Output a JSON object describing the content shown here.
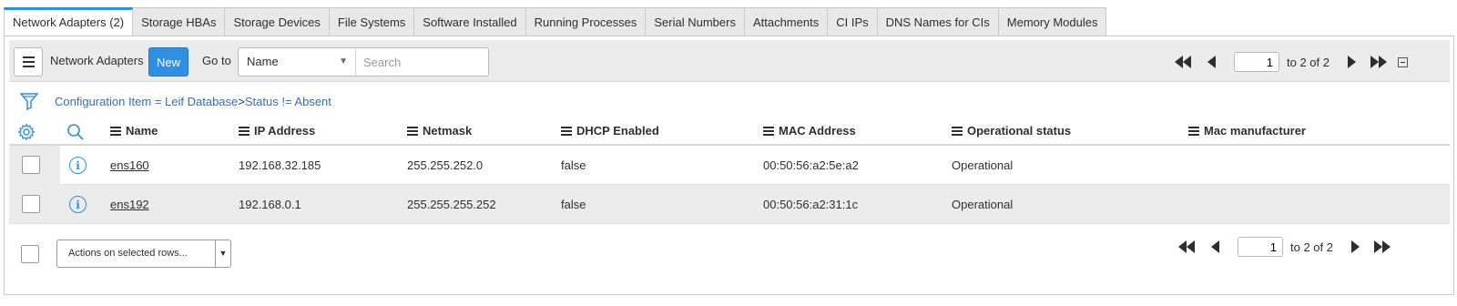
{
  "tabs": [
    {
      "label": "Network Adapters (2)",
      "active": true
    },
    {
      "label": "Storage HBAs"
    },
    {
      "label": "Storage Devices"
    },
    {
      "label": "File Systems"
    },
    {
      "label": "Software Installed"
    },
    {
      "label": "Running Processes"
    },
    {
      "label": "Serial Numbers"
    },
    {
      "label": "Attachments"
    },
    {
      "label": "CI IPs"
    },
    {
      "label": "DNS Names for CIs"
    },
    {
      "label": "Memory Modules"
    }
  ],
  "toolbar": {
    "title": "Network Adapters",
    "new_label": "New",
    "goto_label": "Go to",
    "goto_field": "Name",
    "search_placeholder": "Search",
    "page_value": "1",
    "page_text": "to 2 of 2"
  },
  "filter": {
    "condition1": "Configuration Item = Leif Database",
    "separator": ">",
    "condition2": "Status != Absent"
  },
  "columns": [
    "Name",
    "IP Address",
    "Netmask",
    "DHCP Enabled",
    "MAC Address",
    "Operational status",
    "Mac manufacturer"
  ],
  "rows": [
    {
      "name": "ens160",
      "ip": "192.168.32.185",
      "netmask": "255.255.252.0",
      "dhcp": "false",
      "mac": "00:50:56:a2:5e:a2",
      "status": "Operational",
      "manufacturer": ""
    },
    {
      "name": "ens192",
      "ip": "192.168.0.1",
      "netmask": "255.255.255.252",
      "dhcp": "false",
      "mac": "00:50:56:a2:31:1c",
      "status": "Operational",
      "manufacturer": ""
    }
  ],
  "footer": {
    "actions_label": "Actions on selected rows...",
    "page_value": "1",
    "page_text": "to 2 of 2"
  },
  "colors": {
    "accent": "#2f8fe0",
    "link": "#2f6fc1",
    "toolbar_bg": "#ebebeb"
  },
  "icons": [
    "hamburger-menu-icon",
    "filter-icon",
    "gear-icon",
    "search-icon",
    "info-icon",
    "first-page-icon",
    "previous-page-icon",
    "next-page-icon",
    "last-page-icon",
    "collapse-icon"
  ]
}
